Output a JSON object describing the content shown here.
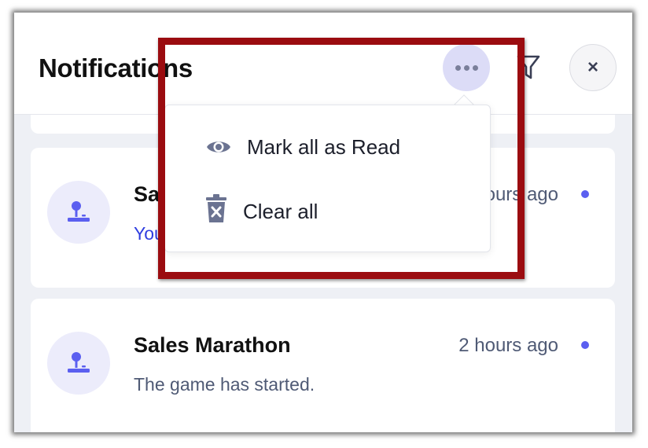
{
  "header": {
    "title": "Notifications"
  },
  "actions": {
    "more_icon": "more-horizontal-icon",
    "filter_icon": "filter-icon",
    "close_label": "×"
  },
  "menu": {
    "items": [
      {
        "label": "Mark all as Read",
        "icon": "eye-icon"
      },
      {
        "label": "Clear all",
        "icon": "trash-icon"
      }
    ]
  },
  "notifications": [
    {
      "title": "Sal",
      "time": "hours ago",
      "body": "You",
      "icon": "joystick-icon",
      "unread": true
    },
    {
      "title": "Sales Marathon",
      "time": "2 hours ago",
      "body": "The game has started.",
      "icon": "joystick-icon",
      "unread": true
    }
  ],
  "colors": {
    "accent": "#5b5ff0",
    "highlight_border": "#9b0c10",
    "more_button_bg": "#dcdcf7",
    "avatar_bg": "#ececfb"
  }
}
